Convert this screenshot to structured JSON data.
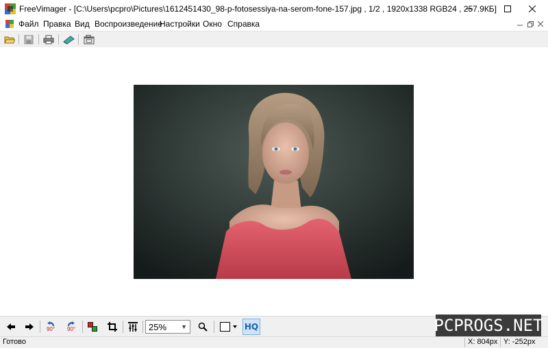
{
  "window": {
    "title": "FreeVimager - [C:\\Users\\pcpro\\Pictures\\1612451430_98-p-fotosessiya-na-serom-fone-157.jpg , 1/2 , 1920x1338 RGB24 , 257.9КБ]",
    "minimize_icon": "minimize-icon",
    "maximize_icon": "maximize-icon",
    "close_icon": "close-icon"
  },
  "menu": {
    "items": [
      "Файл",
      "Правка",
      "Вид",
      "Воспроизведение",
      "Настройки",
      "Окно",
      "Справка"
    ]
  },
  "toolbar": {
    "buttons": [
      "open-folder-icon",
      "save-icon",
      "print-icon",
      "scan-icon",
      "screenshot-icon"
    ]
  },
  "bottom_toolbar": {
    "buttons": [
      "arrow-left-icon",
      "arrow-right-icon",
      "rotate-ccw-90-icon",
      "rotate-cw-90-icon",
      "color-swatch-icon",
      "crop-icon",
      "adjust-sliders-icon"
    ],
    "rotate_ccw_label": "90°",
    "rotate_cw_label": "90°",
    "zoom_value": "25%",
    "hq_label": "HQ"
  },
  "watermark": "PCPROGS.NET",
  "status": {
    "text": "Готово",
    "x": "X: 804px",
    "y": "Y: -252px"
  },
  "colors": {
    "toolbar_bg": "#f0f0f0",
    "hq_bg": "#cfe4f7",
    "photo_top": "#2a3331",
    "shirt": "#d9505a"
  }
}
